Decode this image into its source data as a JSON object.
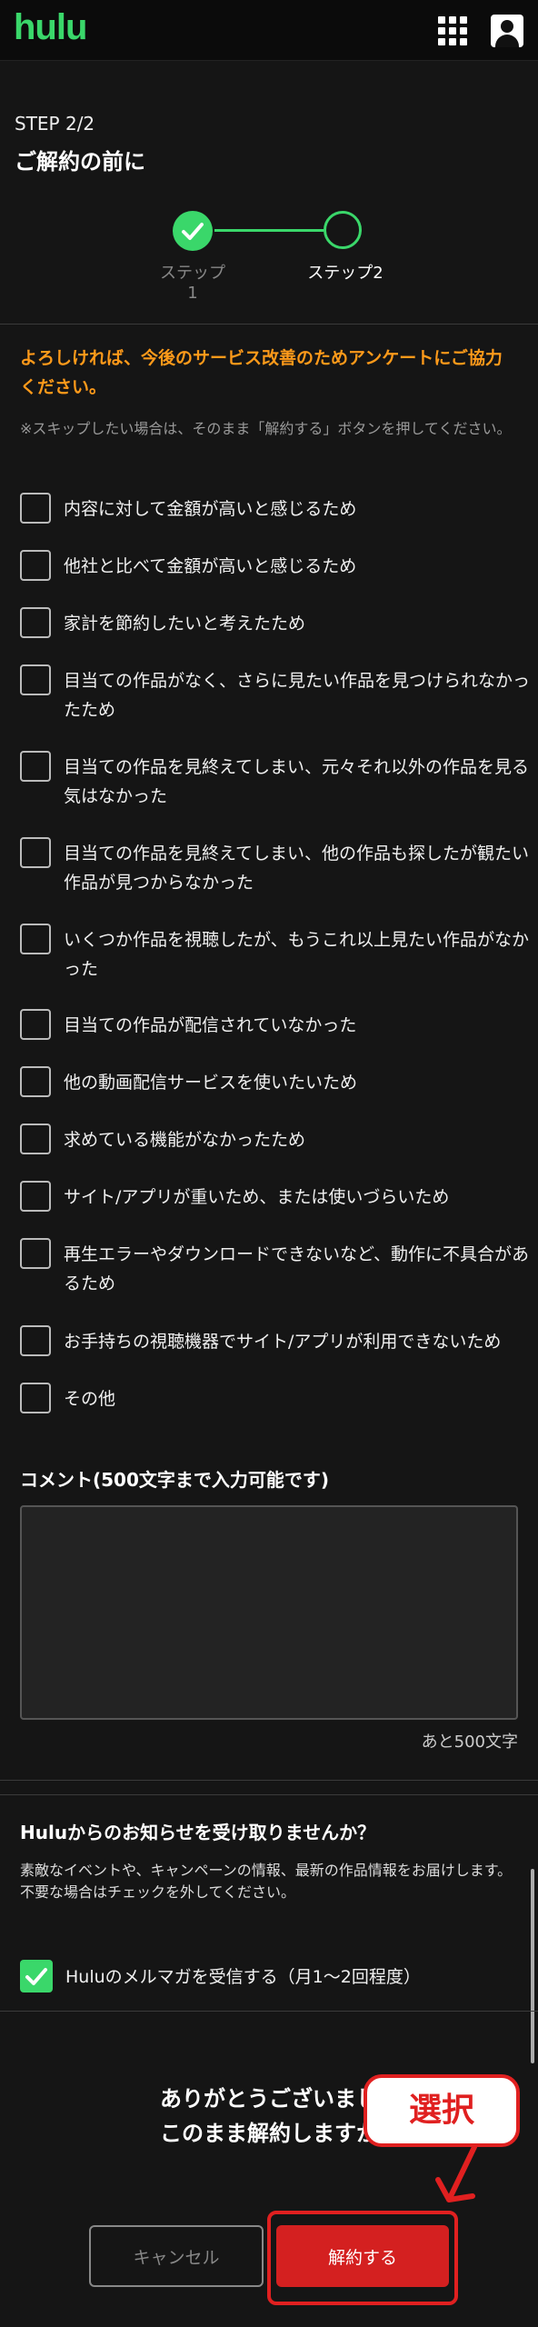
{
  "header": {
    "logo": "hulu",
    "menu_icon": "grid-icon",
    "user_icon": "user-icon"
  },
  "step": {
    "label": "STEP 2/2",
    "title": "ご解約の前に"
  },
  "stepper": {
    "step1": "ステップ1",
    "step2": "ステップ2",
    "step1_state": "completed",
    "step2_state": "current"
  },
  "survey": {
    "lead": "よろしければ、今後のサービス改善のためアンケートにご協力ください。",
    "note": "※スキップしたい場合は、そのまま「解約する」ボタンを押してください。",
    "options": [
      "内容に対して金額が高いと感じるため",
      "他社と比べて金額が高いと感じるため",
      "家計を節約したいと考えたため",
      "目当ての作品がなく、さらに見たい作品を見つけられなかったため",
      "目当ての作品を見終えてしまい、元々それ以外の作品を見る気はなかった",
      "目当ての作品を見終えてしまい、他の作品も探したが観たい作品が見つからなかった",
      "いくつか作品を視聴したが、もうこれ以上見たい作品がなかった",
      "目当ての作品が配信されていなかった",
      "他の動画配信サービスを使いたいため",
      "求めている機能がなかったため",
      "サイト/アプリが重いため、または使いづらいため",
      "再生エラーやダウンロードできないなど、動作に不具合があるため",
      "お手持ちの視聴機器でサイト/アプリが利用できないため",
      "その他"
    ]
  },
  "comment": {
    "label": "コメント(500文字まで入力可能です)",
    "value": "",
    "remaining": "あと500文字"
  },
  "newsletter": {
    "title": "Huluからのお知らせを受け取りませんか？",
    "description": "素敵なイベントや、キャンペーンの情報、最新の作品情報をお届けします。\n不要な場合はチェックを外してください。",
    "checkbox_label": "Huluのメルマガを受信する（月1〜2回程度）",
    "checked": true
  },
  "confirm": {
    "line1": "ありがとうございまし",
    "line2": "このまま解約しますか"
  },
  "callout": {
    "label": "選択"
  },
  "buttons": {
    "cancel": "キャンセル",
    "confirm": "解約する"
  },
  "colors": {
    "accent_green": "#3ad76a",
    "warning_orange": "#ff9a1a",
    "danger_red": "#d42020",
    "background": "#151515"
  }
}
